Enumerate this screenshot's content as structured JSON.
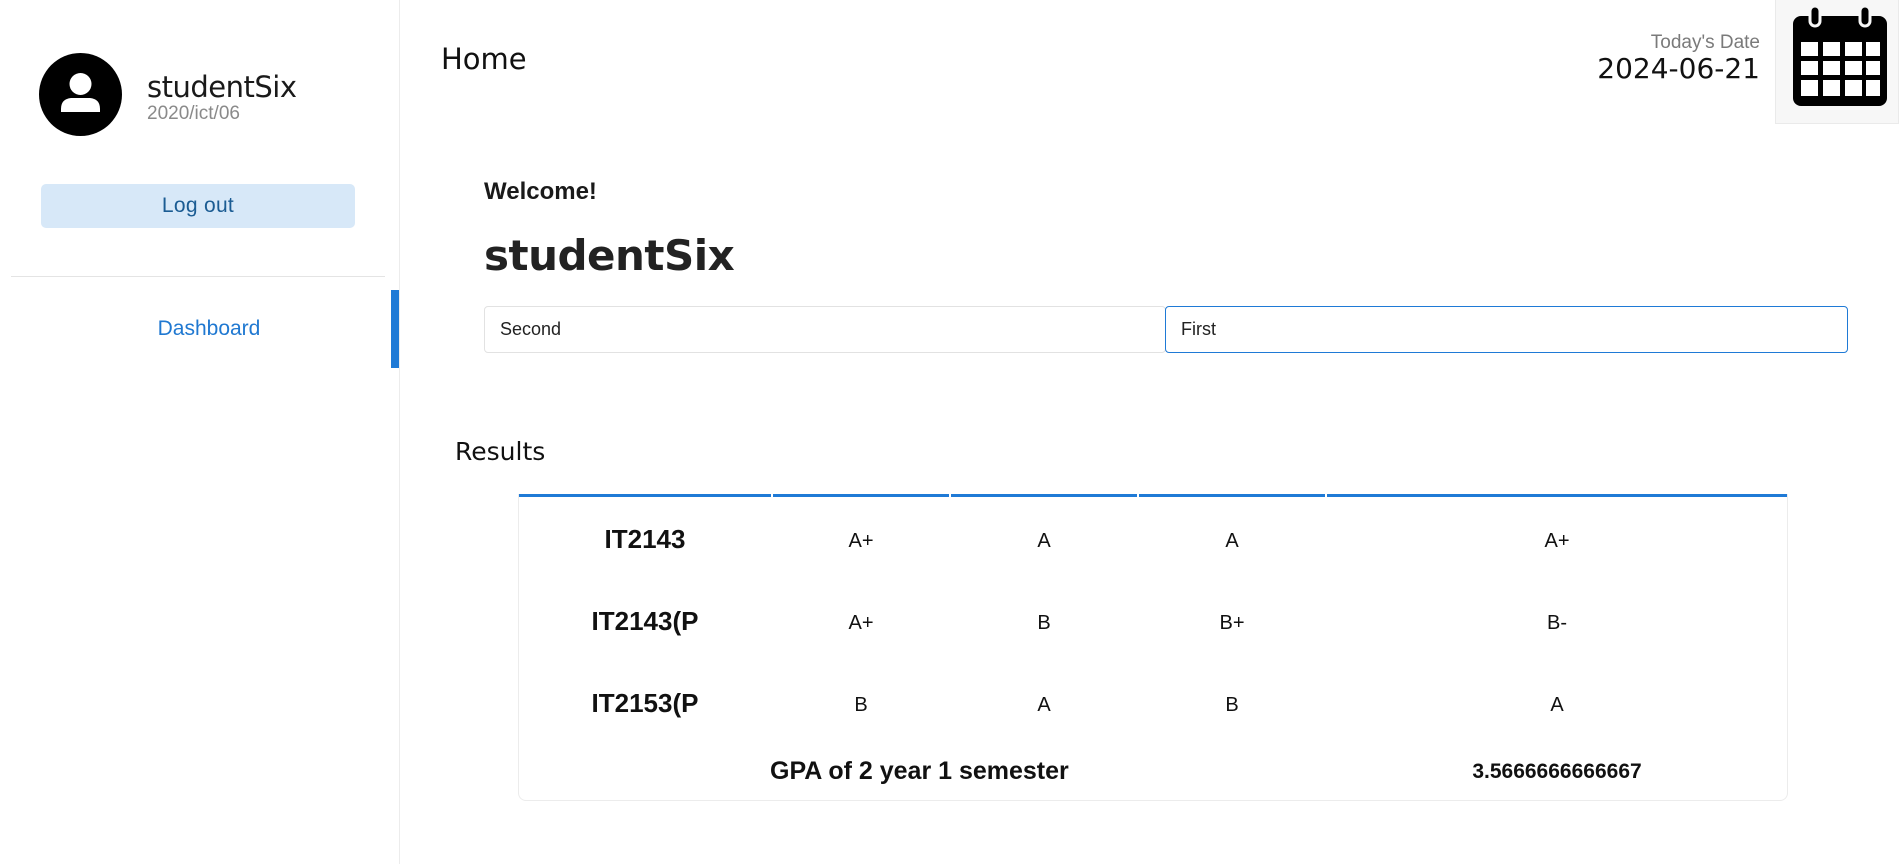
{
  "sidebar": {
    "profile": {
      "name": "studentSix",
      "id": "2020/ict/06",
      "avatar_icon": "user-avatar-icon"
    },
    "logout_label": "Log out",
    "nav": [
      {
        "label": "Dashboard",
        "active": true
      }
    ]
  },
  "header": {
    "title": "Home",
    "date_label": "Today's Date",
    "date_value": "2024-06-21",
    "calendar_icon": "calendar-icon"
  },
  "main": {
    "welcome": "Welcome!",
    "student_name": "studentSix",
    "year_select": {
      "value": "Second"
    },
    "semester_select": {
      "value": "First"
    },
    "results_title": "Results",
    "results": [
      {
        "code": "IT2143",
        "grades": [
          "A+",
          "A",
          "A",
          "A+"
        ]
      },
      {
        "code": "IT2143(P",
        "grades": [
          "A+",
          "B",
          "B+",
          "B-"
        ]
      },
      {
        "code": "IT2153(P",
        "grades": [
          "B",
          "A",
          "B",
          "A"
        ]
      }
    ],
    "gpa_label": "GPA of 2 year 1 semester",
    "gpa_value": "3.5666666666667"
  },
  "colors": {
    "accent": "#1f7ad6",
    "logout_bg": "#d7e8f8",
    "logout_text": "#1b5c93"
  }
}
